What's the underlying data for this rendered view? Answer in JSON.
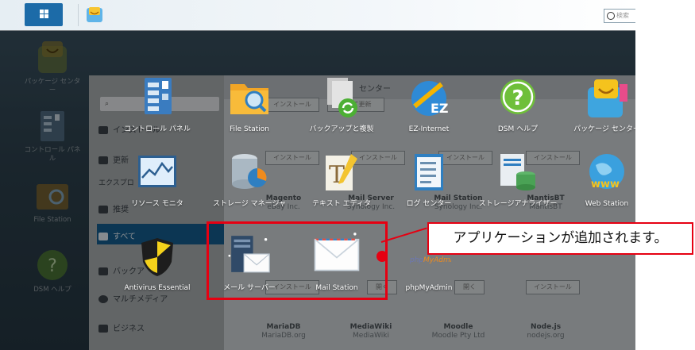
{
  "taskbar": {
    "search_placeholder": "検索"
  },
  "desktop_icons": [
    {
      "label": "パッケージ センター",
      "icon": "package-center-icon"
    },
    {
      "label": "コントロール パネル",
      "icon": "control-panel-icon"
    },
    {
      "label": "File Station",
      "icon": "folder-search-icon"
    },
    {
      "label": "DSM ヘルプ",
      "icon": "help-icon"
    }
  ],
  "package_window": {
    "title_fragment": "センター",
    "search_icon": "search-icon",
    "sidebar": [
      {
        "label": "インストール",
        "icon": "download-icon"
      },
      {
        "label": "更新",
        "icon": "refresh-icon"
      },
      {
        "label": "エクスプロ",
        "icon": ""
      },
      {
        "label": "推奨",
        "icon": "thumbs-up-icon"
      },
      {
        "label": "すべて",
        "icon": "grid-icon"
      },
      {
        "label": "バックア",
        "icon": "backup-icon"
      },
      {
        "label": "マルチメディア",
        "icon": "film-icon"
      },
      {
        "label": "ビジネス",
        "icon": "briefcase-icon"
      }
    ],
    "buttons": {
      "install": "インストール",
      "update_all": "すべて更新",
      "open": "開く"
    },
    "ghost_packages": [
      {
        "name": "Magento",
        "vendor": "eBay Inc."
      },
      {
        "name": "Mail Server",
        "vendor": "Synology Inc."
      },
      {
        "name": "Mail Station",
        "vendor": "Synology Inc."
      },
      {
        "name": "MantisBT",
        "vendor": "MantisBT"
      },
      {
        "name": "MariaDB",
        "vendor": "MariaDB.org"
      },
      {
        "name": "MediaWiki",
        "vendor": "MediaWiki"
      },
      {
        "name": "Moodle",
        "vendor": "Moodle Pty Ltd"
      },
      {
        "name": "Node.js",
        "vendor": "nodejs.org"
      }
    ]
  },
  "main_menu_apps": [
    {
      "label": "コントロール パネル",
      "icon": "control-panel-icon"
    },
    {
      "label": "File Station",
      "icon": "folder-search-icon"
    },
    {
      "label": "バックアップと複製",
      "icon": "backup-replication-icon"
    },
    {
      "label": "EZ-Internet",
      "icon": "ez-internet-icon"
    },
    {
      "label": "DSM ヘルプ",
      "icon": "help-icon"
    },
    {
      "label": "パッケージ センター",
      "icon": "package-center-icon"
    },
    {
      "label": "リソース モニタ",
      "icon": "resource-monitor-icon"
    },
    {
      "label": "ストレージ マネージャ",
      "icon": "storage-manager-icon"
    },
    {
      "label": "テキスト エディタ",
      "icon": "text-editor-icon"
    },
    {
      "label": "ログ センター",
      "icon": "log-center-icon"
    },
    {
      "label": "ストレージアナライザー",
      "icon": "storage-analyzer-icon"
    },
    {
      "label": "Web Station",
      "icon": "web-station-icon"
    },
    {
      "label": "Antivirus Essential",
      "icon": "antivirus-shield-icon"
    },
    {
      "label": "メール サーバー",
      "icon": "mail-server-icon"
    },
    {
      "label": "Mail Station",
      "icon": "mail-station-icon"
    },
    {
      "label": "phpMyAdmin",
      "icon": "phpmyadmin-icon"
    }
  ],
  "callout": {
    "text": "アプリケーションが追加されます。"
  },
  "colors": {
    "highlight": "#e60012",
    "taskbar_accent": "#1c6ba8"
  }
}
